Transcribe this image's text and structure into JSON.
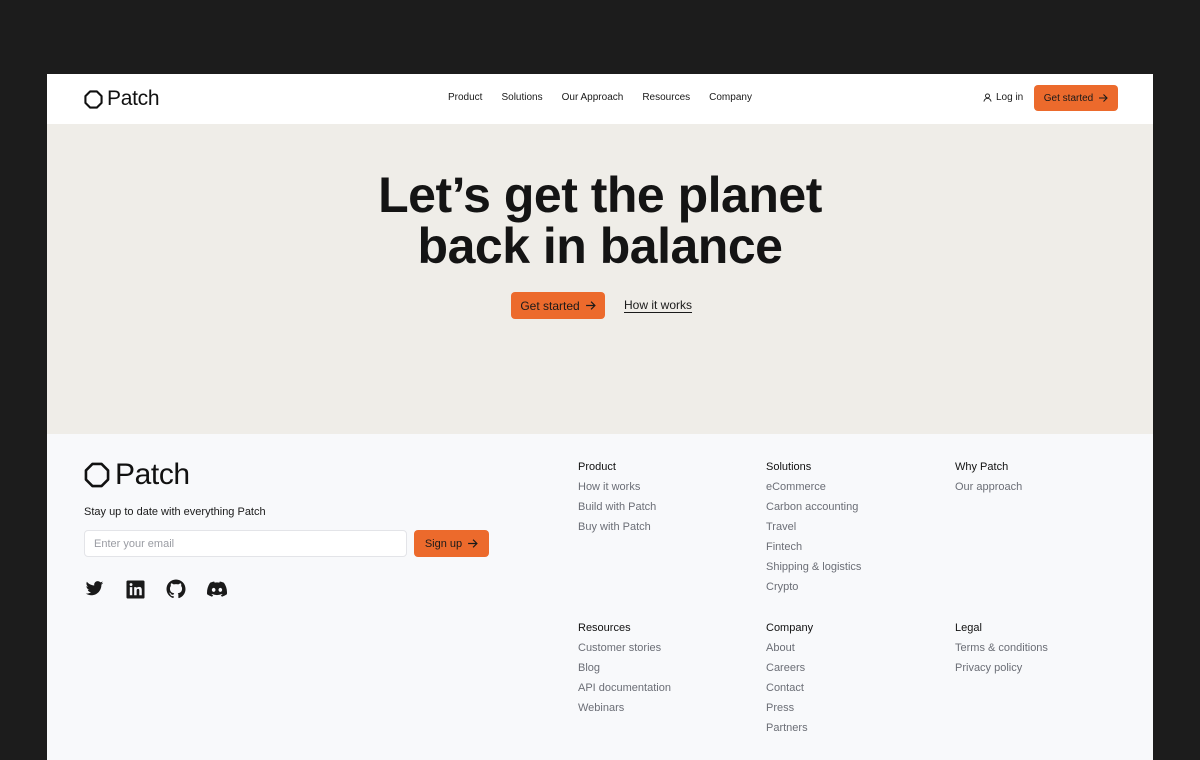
{
  "header": {
    "logo_text": "Patch",
    "nav": [
      "Product",
      "Solutions",
      "Our Approach",
      "Resources",
      "Company"
    ],
    "login_label": "Log in",
    "cta_label": "Get started"
  },
  "hero": {
    "title_line1": "Let’s get the planet",
    "title_line2": "back in balance",
    "cta_label": "Get started",
    "link_label": "How it works"
  },
  "footer": {
    "logo_text": "Patch",
    "tagline": "Stay up to date with everything Patch",
    "email_placeholder": "Enter your email",
    "signup_label": "Sign up",
    "socials": [
      "twitter-icon",
      "linkedin-icon",
      "github-icon",
      "discord-icon"
    ],
    "columns": [
      {
        "title": "Product",
        "links": [
          "How it works",
          "Build with Patch",
          "Buy with Patch"
        ]
      },
      {
        "title": "Solutions",
        "links": [
          "eCommerce",
          "Carbon accounting",
          "Travel",
          "Fintech",
          "Shipping & logistics",
          "Crypto"
        ]
      },
      {
        "title": "Why Patch",
        "links": [
          "Our approach"
        ]
      },
      {
        "title": "Resources",
        "links": [
          "Customer stories",
          "Blog",
          "API documentation",
          "Webinars"
        ]
      },
      {
        "title": "Company",
        "links": [
          "About",
          "Careers",
          "Contact",
          "Press",
          "Partners"
        ]
      },
      {
        "title": "Legal",
        "links": [
          "Terms & conditions",
          "Privacy policy"
        ]
      }
    ]
  },
  "colors": {
    "accent": "#ec6a2c",
    "hero_bg": "#efede8",
    "footer_bg": "#f8f9fb",
    "outer_bg": "#1c1c1c"
  }
}
